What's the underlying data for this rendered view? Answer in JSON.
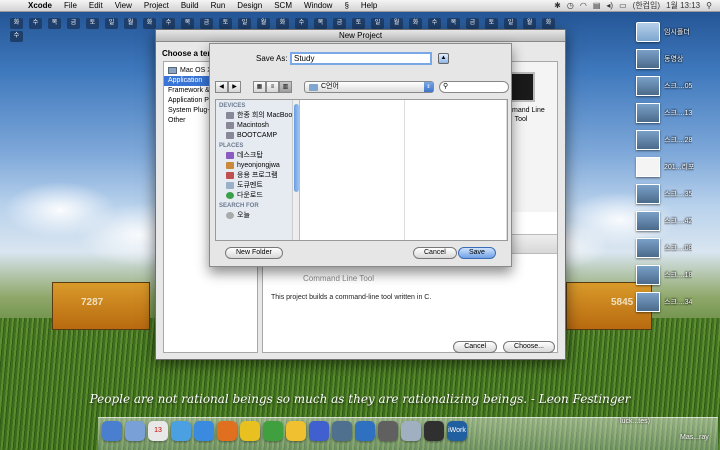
{
  "menubar": {
    "app_name": "Xcode",
    "items": [
      "File",
      "Edit",
      "View",
      "Project",
      "Build",
      "Run",
      "Design",
      "SCM",
      "Window",
      "Help"
    ],
    "input_method": "(한컴입)",
    "clock": "1월 13:13"
  },
  "stickers": [
    "화",
    "수",
    "목",
    "금",
    "토",
    "일",
    "월",
    "화",
    "수",
    "목",
    "금",
    "토",
    "일",
    "월",
    "화",
    "수",
    "목",
    "금",
    "토",
    "일",
    "월",
    "화",
    "수",
    "목",
    "금",
    "토",
    "일",
    "월",
    "화",
    "수"
  ],
  "desktop_icons": [
    {
      "label": "임시폴더",
      "kind": "folder"
    },
    {
      "label": "동영상",
      "kind": "hdd"
    },
    {
      "label": "스크....05",
      "kind": "shot"
    },
    {
      "label": "스크....13",
      "kind": "shot"
    },
    {
      "label": "스크....28",
      "kind": "shot"
    },
    {
      "label": "201...리포",
      "kind": "doc"
    },
    {
      "label": "스크....35",
      "kind": "shot"
    },
    {
      "label": "스크....42",
      "kind": "shot"
    },
    {
      "label": "스크....08",
      "kind": "shot"
    },
    {
      "label": "스크....18",
      "kind": "shot"
    },
    {
      "label": "스크....34",
      "kind": "shot"
    }
  ],
  "new_project": {
    "title": "New Project",
    "heading": "Choose a template for your new project:",
    "sidebar_group": "Mac OS X",
    "categories": [
      {
        "label": "Application",
        "selected": true
      },
      {
        "label": "Framework & Library",
        "selected": false
      },
      {
        "label": "Application Plug-in",
        "selected": false
      },
      {
        "label": "System Plug-in",
        "selected": false
      },
      {
        "label": "Other",
        "selected": false
      }
    ],
    "template_label": "Command Line Tool",
    "desc_title": "Command Line Tool",
    "description": "This project builds a command-line tool written in C.",
    "cancel_label": "Cancel",
    "choose_label": "Choose..."
  },
  "save_sheet": {
    "save_as_label": "Save As:",
    "save_as_value": "Study",
    "location": "C언어",
    "devices_header": "DEVICES",
    "devices": [
      "한종 희의 MacBook",
      "Macintosh",
      "BOOTCAMP"
    ],
    "places_header": "PLACES",
    "places": [
      "데스크탑",
      "hyeonjongjwa",
      "응용 프로그램",
      "도큐멘트",
      "다운로드"
    ],
    "search_header": "SEARCH FOR",
    "search_items": [
      "오늘"
    ],
    "new_folder_label": "New Folder",
    "cancel_label": "Cancel",
    "save_label": "Save"
  },
  "wallpaper": {
    "train_left_number": "7287",
    "train_right_number": "5845",
    "quote": "People are not rational beings so much as they are rationalizing beings. - Leon Festinger"
  },
  "dock": {
    "icons": [
      "finder",
      "mail",
      "calendar",
      "itunes",
      "safari",
      "firefox",
      "chrome",
      "utorrent",
      "adium",
      "chat",
      "photo",
      "xcode",
      "network",
      "preview",
      "terminal",
      "iwork"
    ],
    "calendar_day": "13",
    "iwork_label": "iWork",
    "label_1": "luck...tes)",
    "label_2": "Mas...ray"
  }
}
